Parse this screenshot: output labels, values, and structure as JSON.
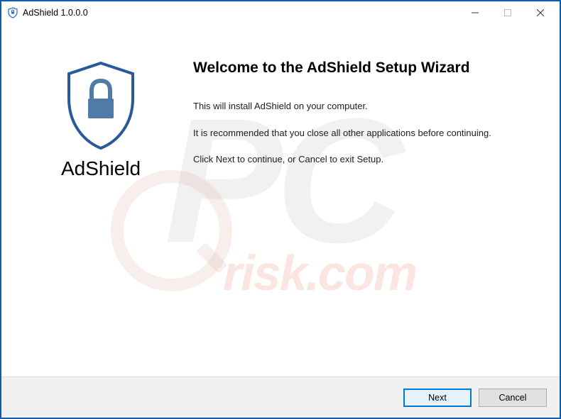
{
  "titlebar": {
    "title": "AdShield 1.0.0.0"
  },
  "sidebar": {
    "app_name": "AdShield"
  },
  "main": {
    "heading": "Welcome to the AdShield Setup Wizard",
    "line1": "This will install AdShield on your computer.",
    "line2": "It is recommended that you close all other applications before continuing.",
    "line3": "Click Next to continue, or Cancel to exit Setup."
  },
  "footer": {
    "next_label": "Next",
    "cancel_label": "Cancel"
  },
  "watermark": {
    "top": "PC",
    "bottom": "risk.com"
  }
}
